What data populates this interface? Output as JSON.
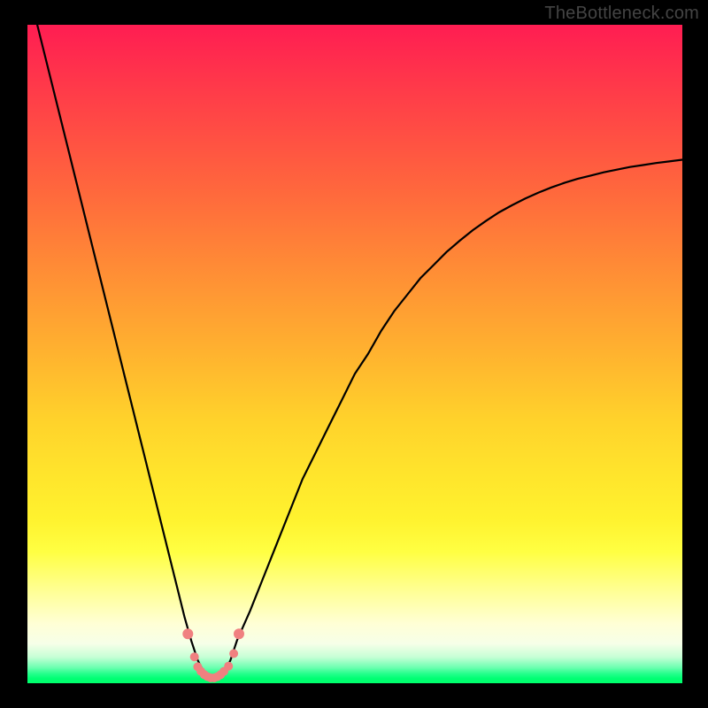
{
  "watermark": "TheBottleneck.com",
  "colors": {
    "frame": "#000000",
    "gradient_top": "#ff1d52",
    "gradient_bottom": "#00ff6c",
    "curve": "#000000",
    "marker": "#f08080"
  },
  "chart_data": {
    "type": "line",
    "title": "",
    "xlabel": "",
    "ylabel": "",
    "xlim": [
      0,
      100
    ],
    "ylim": [
      0,
      100
    ],
    "x": [
      0,
      1,
      2,
      3,
      4,
      5,
      6,
      7,
      8,
      9,
      10,
      11,
      12,
      13,
      14,
      15,
      16,
      17,
      18,
      19,
      20,
      21,
      22,
      23,
      24,
      25,
      26,
      27,
      28,
      29,
      30,
      31,
      32,
      34,
      36,
      38,
      40,
      42,
      44,
      46,
      48,
      50,
      52,
      54,
      56,
      58,
      60,
      62,
      64,
      66,
      68,
      70,
      72,
      74,
      76,
      78,
      80,
      82,
      84,
      86,
      88,
      90,
      92,
      94,
      96,
      98,
      100
    ],
    "values": [
      106,
      102,
      98,
      94,
      90,
      86,
      82,
      78,
      74,
      70,
      66,
      62,
      58,
      54,
      50,
      46,
      42,
      38,
      34,
      30,
      26,
      22,
      18,
      14,
      10,
      6.5,
      3.5,
      1.5,
      0.7,
      0.7,
      1.5,
      3.5,
      6.5,
      11,
      16,
      21,
      26,
      31,
      35,
      39,
      43,
      47,
      50,
      53.5,
      56.5,
      59,
      61.5,
      63.5,
      65.5,
      67.2,
      68.8,
      70.2,
      71.5,
      72.6,
      73.6,
      74.5,
      75.3,
      76.0,
      76.6,
      77.1,
      77.6,
      78.0,
      78.4,
      78.7,
      79.0,
      79.25,
      79.5
    ],
    "markers_x": [
      24.5,
      25.5,
      26,
      26.5,
      27,
      27.5,
      28,
      28.5,
      29,
      29.5,
      30,
      30.7,
      31.5,
      32.3
    ],
    "markers_y": [
      7.5,
      4.0,
      2.5,
      1.8,
      1.3,
      1.0,
      0.8,
      0.8,
      1.0,
      1.3,
      1.8,
      2.6,
      4.5,
      7.5
    ]
  }
}
